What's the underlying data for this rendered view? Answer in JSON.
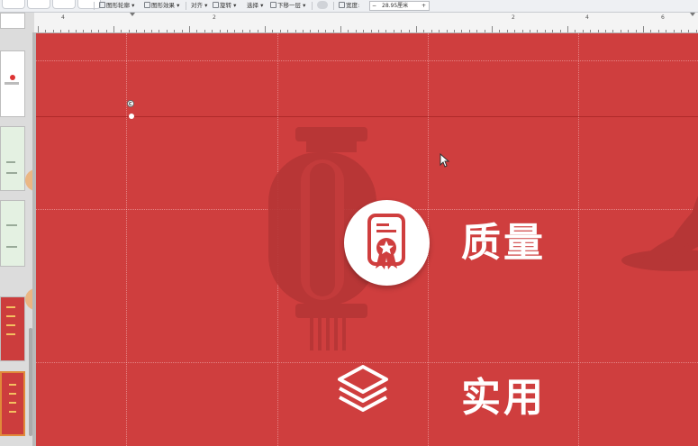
{
  "toolbar": {
    "items": [
      "图形轮廓",
      "图形效果",
      "对齐",
      "旋转",
      "选择",
      "下移一层"
    ],
    "width_label": "宽度:",
    "width_value": "28.95厘米",
    "decrease": "−",
    "increase": "+"
  },
  "ruler": {
    "labels": [
      "4",
      "2",
      "2",
      "4",
      "6"
    ]
  },
  "slide": {
    "features": [
      {
        "label": "质量",
        "icon": "certificate-icon"
      },
      {
        "label": "实用",
        "icon": "layers-icon"
      }
    ],
    "background_color": "#cf3e3e",
    "decor": [
      "lantern-icon",
      "fan-icon"
    ]
  },
  "selection": {
    "handles": [
      "rotate-handle",
      "resize-handle"
    ]
  },
  "cursor": "mouse-pointer-icon"
}
